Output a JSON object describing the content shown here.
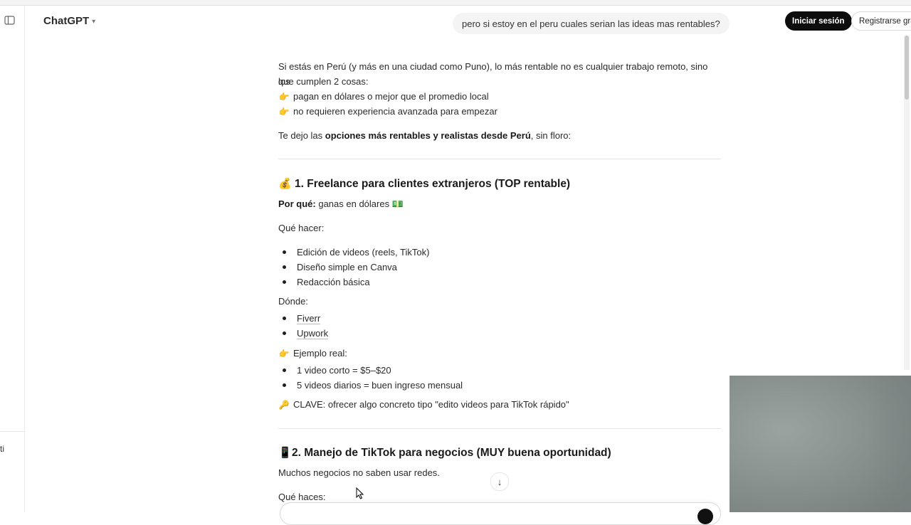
{
  "app": {
    "title": "ChatGPT"
  },
  "header": {
    "user_message": "pero si estoy en el peru cuales serian las ideas mas rentables?",
    "login_label": "Iniciar sesión",
    "signup_label": "Registrarse gratis"
  },
  "sidebar": {
    "partial_text": "ti"
  },
  "answer": {
    "intro_1": "Si estás en Perú (y más en una ciudad como Puno), lo más rentable no es cualquier trabajo remoto, sino los",
    "intro_2": "que cumplen 2 cosas:",
    "point_1": "pagan en dólares o mejor que el promedio local",
    "point_2": "no requieren experiencia avanzada para empezar",
    "lead_pre": "Te dejo las ",
    "lead_bold": "opciones más rentables y realistas desde Perú",
    "lead_post": ", sin floro:",
    "emoji_hand": "👉",
    "section1": {
      "emoji": "💰",
      "title": "1. Freelance para clientes extranjeros (TOP rentable)",
      "why_label": "Por qué:",
      "why_text": " ganas en dólares ",
      "why_emoji": "💵",
      "what_label": "Qué hacer:",
      "what_items": [
        "Edición de videos (reels, TikTok)",
        "Diseño simple en Canva",
        "Redacción básica"
      ],
      "where_label": "Dónde:",
      "where_items": [
        "Fiverr",
        "Upwork"
      ],
      "example_label": "Ejemplo real:",
      "example_items": [
        "1 video corto = $5–$20",
        "5 videos diarios = buen ingreso mensual"
      ],
      "key_emoji": "🔑",
      "key_text": "CLAVE: ofrecer algo concreto tipo \"edito videos para TikTok rápido\""
    },
    "section2": {
      "emoji": "📱",
      "title": "2. Manejo de TikTok para negocios (MUY buena oportunidad)",
      "text": "Muchos negocios no saben usar redes.",
      "what_label": "Qué haces:"
    }
  },
  "icons": {
    "scroll_down": "↓",
    "chevron": "⌄"
  }
}
